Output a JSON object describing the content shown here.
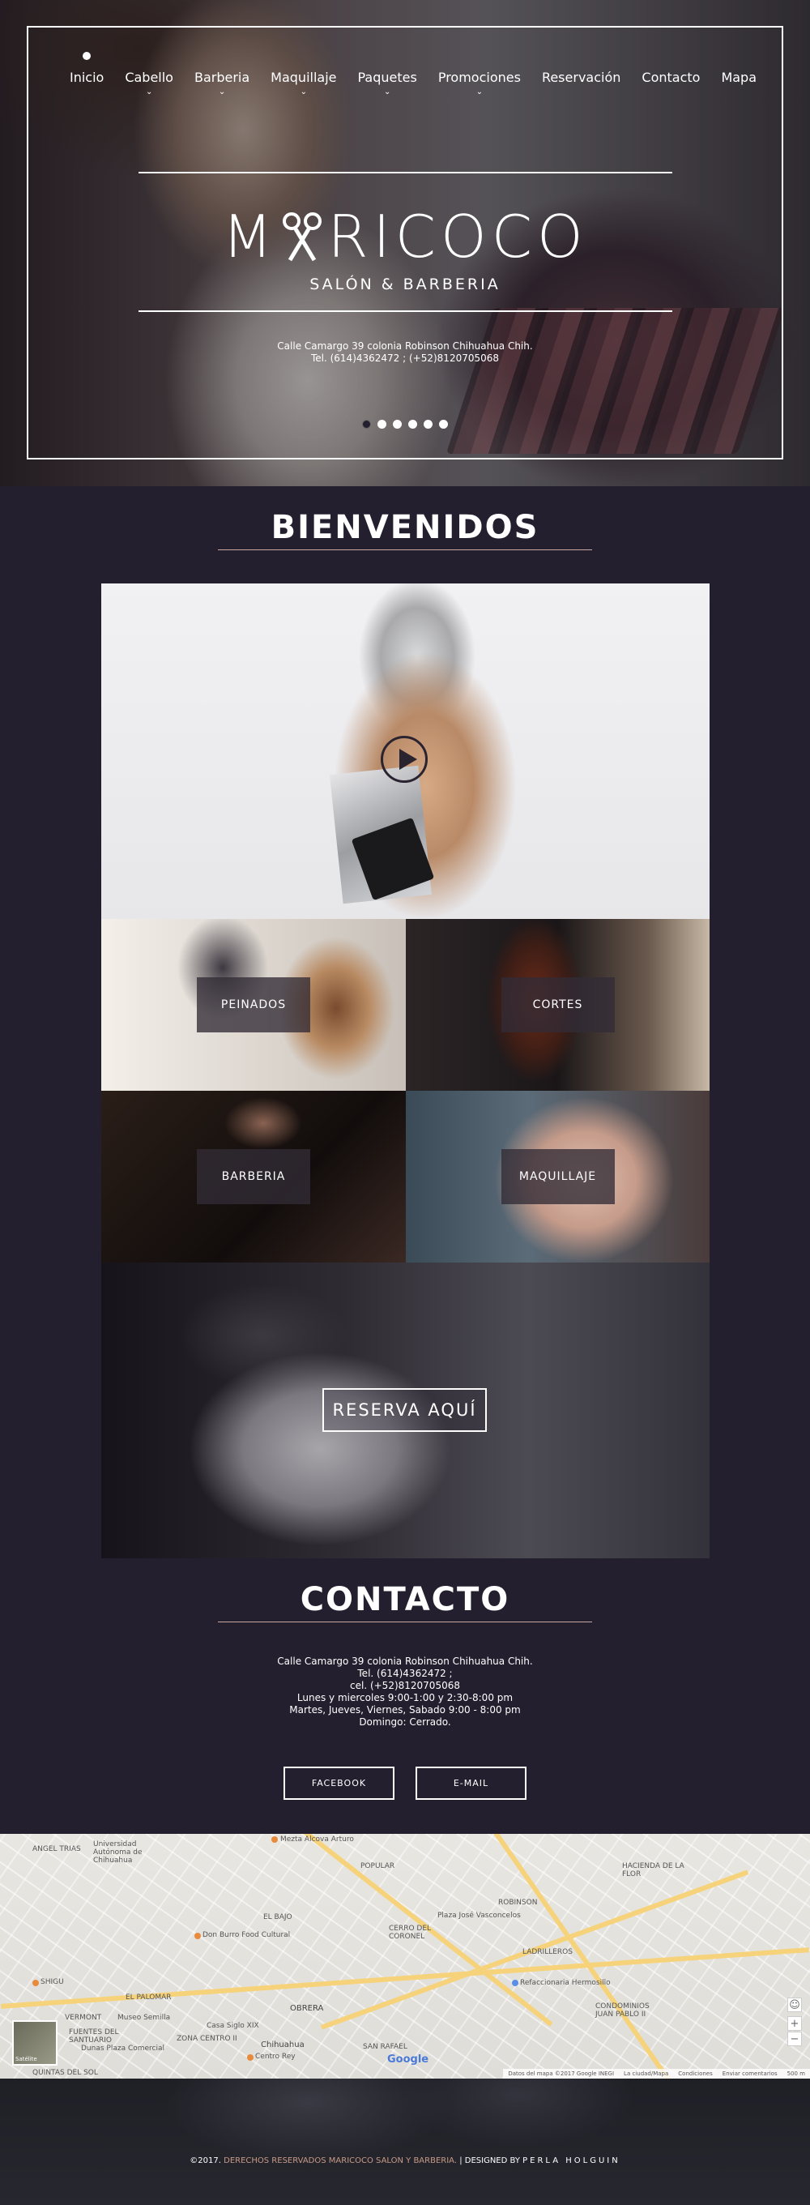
{
  "nav": {
    "items": [
      {
        "label": "Inicio",
        "chevron": ""
      },
      {
        "label": "Cabello",
        "chevron": "⌄"
      },
      {
        "label": "Barberia",
        "chevron": "⌄"
      },
      {
        "label": "Maquillaje",
        "chevron": "⌄"
      },
      {
        "label": "Paquetes",
        "chevron": "⌄"
      },
      {
        "label": "Promociones",
        "chevron": "⌄"
      },
      {
        "label": "Reservación",
        "chevron": ""
      },
      {
        "label": "Contacto",
        "chevron": ""
      },
      {
        "label": "Mapa",
        "chevron": ""
      }
    ]
  },
  "hero": {
    "logo_before": "M",
    "logo_after": "RICOCO",
    "tagline": "SALÓN & BARBERIA",
    "address": "Calle Camargo 39 colonia Robinson Chihuahua Chih.",
    "phone": "Tel. (614)4362472 ; (+52)8120705068",
    "slide_count": 6,
    "active_slide": 1
  },
  "welcome": {
    "title": "BIENVENIDOS"
  },
  "services": {
    "peinados": "PEINADOS",
    "cortes": "CORTES",
    "barberia": "BARBERIA",
    "maquillaje": "MAQUILLAJE"
  },
  "reserva": {
    "label": "RESERVA AQUÍ"
  },
  "contacto": {
    "title": "CONTACTO",
    "lines": [
      "Calle Camargo 39 colonia Robinson Chihuahua Chih.",
      "Tel. (614)4362472 ;",
      "cel. (+52)8120705068",
      "Lunes y miercoles 9:00-1:00 y 2:30-8:00 pm",
      "Martes, Jueves, Viernes, Sabado 9:00 - 8:00 pm",
      "Domingo: Cerrado."
    ],
    "facebook": "FACEBOOK",
    "email": "E-MAIL"
  },
  "map": {
    "labels": {
      "l1": "Universidad Autónoma de Chihuahua",
      "l2": "ANGEL TRIAS",
      "l3": "Mezta Alcova Arturo",
      "l4": "POPULAR",
      "l5": "Don Burro Food Cultural",
      "l6": "EL BAJO",
      "l7": "CERRO DEL CORONEL",
      "l8": "ROBINSON",
      "l9": "HACIENDA DE LA FLOR",
      "l10": "Plaza José Vasconcelos",
      "l11": "LADRILLEROS",
      "l12": "Refaccionaria Hermosillo",
      "l13": "OBRERA",
      "l14": "Chihuahua",
      "l15": "Dunas Plaza Comercial",
      "l16": "Centro Rey",
      "l17": "SAN RAFAEL",
      "l18": "QUINTAS DEL SOL",
      "l19": "VERMONT",
      "l20": "EL PALOMAR",
      "l21": "Museo Semilla",
      "l22": "Casa Siglo XIX",
      "l23": "FUENTES DEL SANTUARIO",
      "l24": "ZONA CENTRO II",
      "l25": "CONDOMINIOS JUAN PABLO II",
      "l26": "SHIGU",
      "l27": "Google",
      "l28": "Satélite"
    },
    "attribution": [
      "Datos del mapa ©2017 Google INEGI",
      "La ciudad/Mapa",
      "Condiciones",
      "Enviar comentarios",
      "500 m"
    ],
    "zoom_in": "+",
    "zoom_out": "−"
  },
  "footer": {
    "prefix": "©2017.",
    "rights": "DERECHOS RESERVADOS MARICOCO SALON Y BARBERIA.",
    "divider": "|",
    "designed": "DESIGNED BY",
    "designer": "PERLA HOLGUIN"
  }
}
